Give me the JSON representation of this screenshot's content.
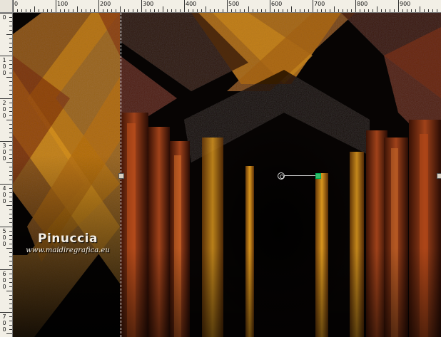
{
  "ruler": {
    "top_labels": [
      "0",
      "100",
      "200",
      "300",
      "400",
      "500",
      "600",
      "700",
      "800",
      "900"
    ],
    "left_labels": [
      "0",
      "100",
      "200",
      "300",
      "400",
      "500",
      "600",
      "700"
    ]
  },
  "watermark": {
    "name": "Pinuccia",
    "url": "www.maidiregrafica.eu"
  },
  "colors": {
    "amber": "#c07a10",
    "copper": "#8a3a12",
    "dark": "#050302",
    "rotate_handle": "#2fbf6a"
  }
}
